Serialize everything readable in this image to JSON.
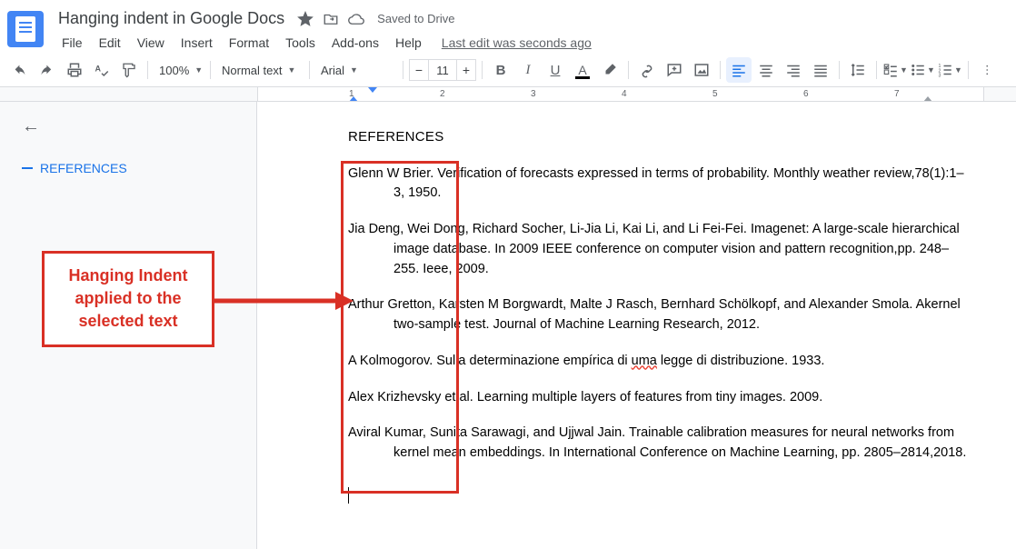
{
  "header": {
    "title": "Hanging indent in Google Docs",
    "saved_status": "Saved to Drive",
    "last_edit": "Last edit was seconds ago"
  },
  "menu": {
    "file": "File",
    "edit": "Edit",
    "view": "View",
    "insert": "Insert",
    "format": "Format",
    "tools": "Tools",
    "addons": "Add-ons",
    "help": "Help"
  },
  "toolbar": {
    "zoom": "100%",
    "style": "Normal text",
    "font": "Arial",
    "font_size": "11"
  },
  "outline": {
    "heading": "REFERENCES"
  },
  "annotation": {
    "line1": "Hanging Indent",
    "line2": "applied to the",
    "line3": "selected text"
  },
  "document": {
    "heading": "REFERENCES",
    "refs": [
      {
        "text": "Glenn W Brier. Verification of forecasts expressed in terms of probability. Monthly weather review,78(1):1–3, 1950."
      },
      {
        "text": "Jia Deng, Wei Dong, Richard Socher, Li-Jia Li, Kai Li, and Li Fei-Fei. Imagenet: A large-scale hierarchical image database. In 2009 IEEE conference on computer vision and pattern recognition,pp. 248–255. Ieee, 2009."
      },
      {
        "text": "Arthur Gretton, Karsten M Borgwardt, Malte J Rasch, Bernhard Schölkopf, and Alexander Smola. Akernel two-sample test. Journal of Machine Learning Research, 2012."
      },
      {
        "text_pre": "A Kolmogorov. Sulla determinazione empírica di ",
        "sq": "uma",
        "text_post": " legge di distribuzione. 1933."
      },
      {
        "text": "Alex Krizhevsky et al. Learning multiple layers of features from tiny images. 2009."
      },
      {
        "text": "Aviral Kumar, Sunita Sarawagi, and Ujjwal Jain. Trainable calibration measures for neural networks from kernel mean embeddings. In International Conference on Machine Learning, pp. 2805–2814,2018."
      }
    ]
  },
  "ruler": {
    "marks": [
      "1",
      "2",
      "3",
      "4",
      "5",
      "6",
      "7"
    ]
  }
}
